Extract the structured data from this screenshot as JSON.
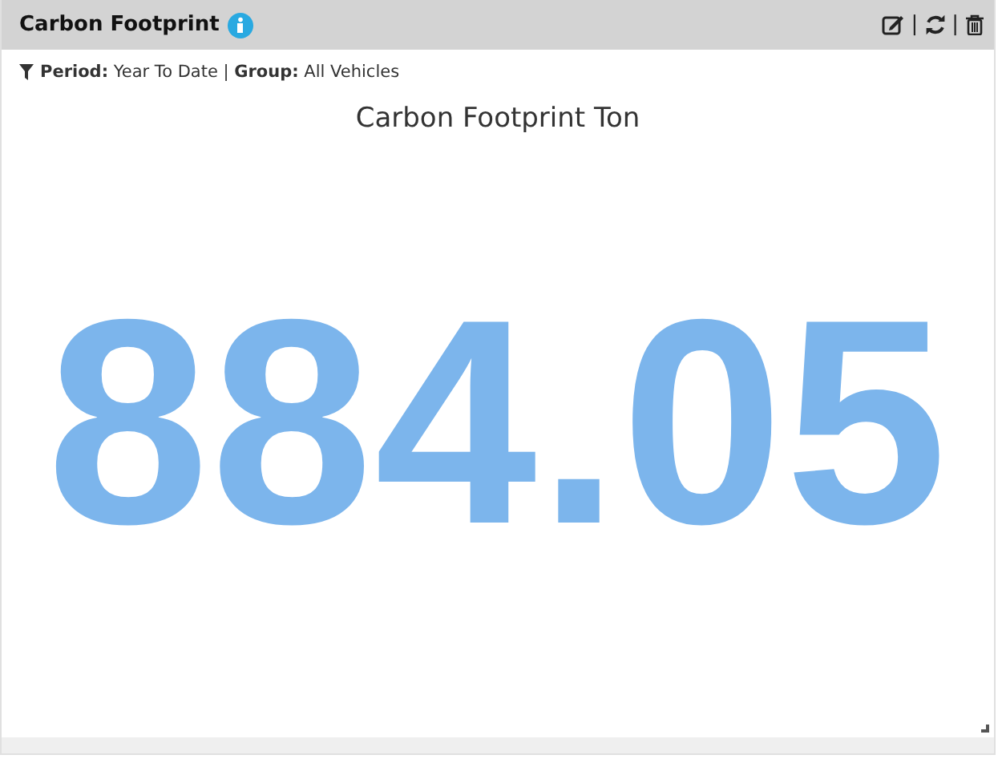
{
  "widget": {
    "title": "Carbon Footprint",
    "filter": "**Period:** Year To Date | **Group:** All Vehicles",
    "chart_title": "Carbon Footprint Ton",
    "value": "884.05",
    "separators": [
      "|",
      "|"
    ]
  }
}
